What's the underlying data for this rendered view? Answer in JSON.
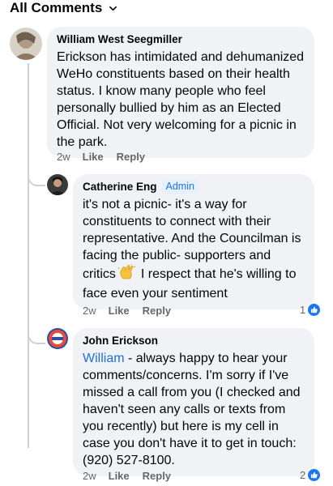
{
  "header": {
    "title": "All Comments",
    "chevron_icon": "chevron-down-icon"
  },
  "colors": {
    "bubble": "#f0f2f5",
    "link": "#216fdb",
    "like": "#1877f2",
    "meta": "#65676b"
  },
  "comments": [
    {
      "author": "William West Seegmiller",
      "text": "Erickson has intimidated and dehumanized WeHo constituents based on their health status. I know many people who feel personally bullied by him as an Elected Official. Not very welcoming for a picnic in the park.",
      "time": "2w",
      "like_label": "Like",
      "reply_label": "Reply"
    },
    {
      "author": "Catherine Eng",
      "badge": "Admin",
      "text_part1": "it's not a picnic- it's a way for constituents to connect with their representative. And the Councilman is facing the public- supporters and critics",
      "emoji": "clapping-hands-icon",
      "text_part2": "I respect that he's willing to face even your sentiment",
      "time": "2w",
      "like_label": "Like",
      "reply_label": "Reply",
      "reaction_count": "1"
    },
    {
      "author": "John Erickson",
      "mention": "William",
      "text": " - always happy to hear your comments/concerns.  I'm sorry if I've missed a call from you (I checked and haven't seen any calls or texts from you recently) but here is my cell in case you don't have it to get in touch: (920) 527-8100.",
      "time": "2w",
      "like_label": "Like",
      "reply_label": "Reply",
      "reaction_count": "2"
    }
  ]
}
